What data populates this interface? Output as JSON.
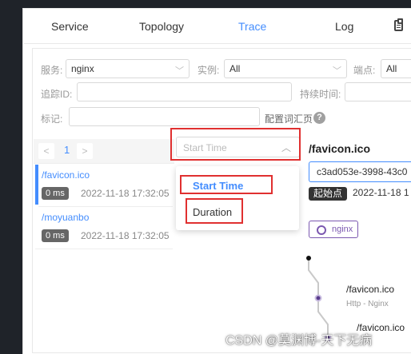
{
  "tabs": [
    {
      "label": "Service"
    },
    {
      "label": "Topology"
    },
    {
      "label": "Trace"
    },
    {
      "label": "Log"
    }
  ],
  "active_tab": "Trace",
  "filters": {
    "service_label": "服务:",
    "service_value": "nginx",
    "instance_label": "实例:",
    "instance_value": "All",
    "endpoint_label": "端点:",
    "endpoint_value": "All",
    "trace_id_label": "追踪ID:",
    "trace_id_value": "",
    "duration_label": "持续时间:",
    "duration_value": "",
    "tags_label": "标记:",
    "tags_value": "",
    "config_label": "配置词汇页"
  },
  "pager": {
    "page": "1"
  },
  "sort": {
    "placeholder": "Start Time",
    "options": [
      "Start Time",
      "Duration"
    ]
  },
  "traces": [
    {
      "name": "/favicon.ico",
      "duration": "0 ms",
      "date": "2022-11-18 17:32:05"
    },
    {
      "name": "/moyuanbo",
      "duration": "0 ms",
      "date": "2022-11-18 17:32:05"
    }
  ],
  "detail": {
    "title": "/favicon.ico",
    "trace_id": "c3ad053e-3998-43c0",
    "start_label": "起始点",
    "start_date": "2022-11-18 1",
    "service_tag": "nginx"
  },
  "tree": [
    {
      "label": "/favicon.ico",
      "sub": "Http - Nginx"
    },
    {
      "label": "/favicon.ico",
      "sub": ""
    }
  ],
  "watermark": "CSDN @莫渊博-天下无病",
  "colors": {
    "accent": "#448dfe",
    "highlight": "#e03030",
    "service": "#7b58b0"
  }
}
